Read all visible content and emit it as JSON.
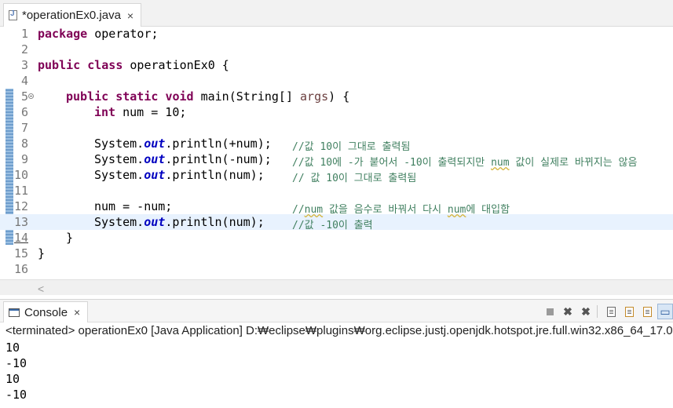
{
  "editor": {
    "tab_label": "*operationEx0.java",
    "tab_close": "×",
    "icons": {
      "file": "java-file-icon",
      "fold": "fold-collapse-icon"
    }
  },
  "code": {
    "line_numbers": [
      "1",
      "2",
      "3",
      "4",
      "5",
      "6",
      "7",
      "8",
      "9",
      "10",
      "11",
      "12",
      "13",
      "14",
      "15",
      "16"
    ],
    "l1_kw": "package",
    "l1_rest": " operator;",
    "l3_kw1": "public",
    "l3_kw2": "class",
    "l3_rest": " operationEx0 {",
    "l5_kw1": "public",
    "l5_kw2": "static",
    "l5_kw3": "void",
    "l5_mid": " main(String[] ",
    "l5_var": "args",
    "l5_end": ") {",
    "l6_kw": "int",
    "l6_rest": " num = 10;",
    "sys": "System.",
    "out": "out",
    "l8_call": ".println(+num);",
    "l8_comment": "//값 10이 그대로 출력됨",
    "l9_call": ".println(-num);",
    "l9_comment_a": "//값 10에 -가 붙어서 -10이 출력되지만 ",
    "l9_comment_num": "num",
    "l9_comment_b": " 값이 실제로 바뀌지는 않음",
    "l10_call": ".println(num);",
    "l10_comment": "// 값 10이 그대로 출력됨",
    "l12_code": "num = -num;",
    "l12_comment_a": "//",
    "l12_comment_num": "num",
    "l12_comment_b": " 값을 음수로 바꿔서 다시 ",
    "l12_comment_num2": "num",
    "l12_comment_c": "에 대입함",
    "l13_call": ".println(num);",
    "l13_comment": "//값 -10이 출력",
    "l14": "}",
    "l15": "}"
  },
  "scrollbar": {
    "left_arrow": "<"
  },
  "console": {
    "tab_label": "Console",
    "tab_close": "×",
    "status": "<terminated> operationEx0 [Java Application] D:₩eclipse₩plugins₩org.eclipse.justj.openjdk.hotspot.jre.full.win32.x86_64_17.0.",
    "output": [
      "10",
      "-10",
      "10",
      "-10"
    ],
    "toolbar_icons": [
      "terminate-icon",
      "remove-launch-icon",
      "remove-all-terminated-icon",
      "scroll-lock-icon",
      "word-wrap-icon",
      "show-on-output-icon",
      "pin-console-icon"
    ]
  },
  "colors": {
    "keyword": "#7f0055",
    "field": "#0000c0",
    "comment": "#3f7f5f",
    "variable": "#6a3e3e",
    "current_line": "#e8f2fe"
  }
}
